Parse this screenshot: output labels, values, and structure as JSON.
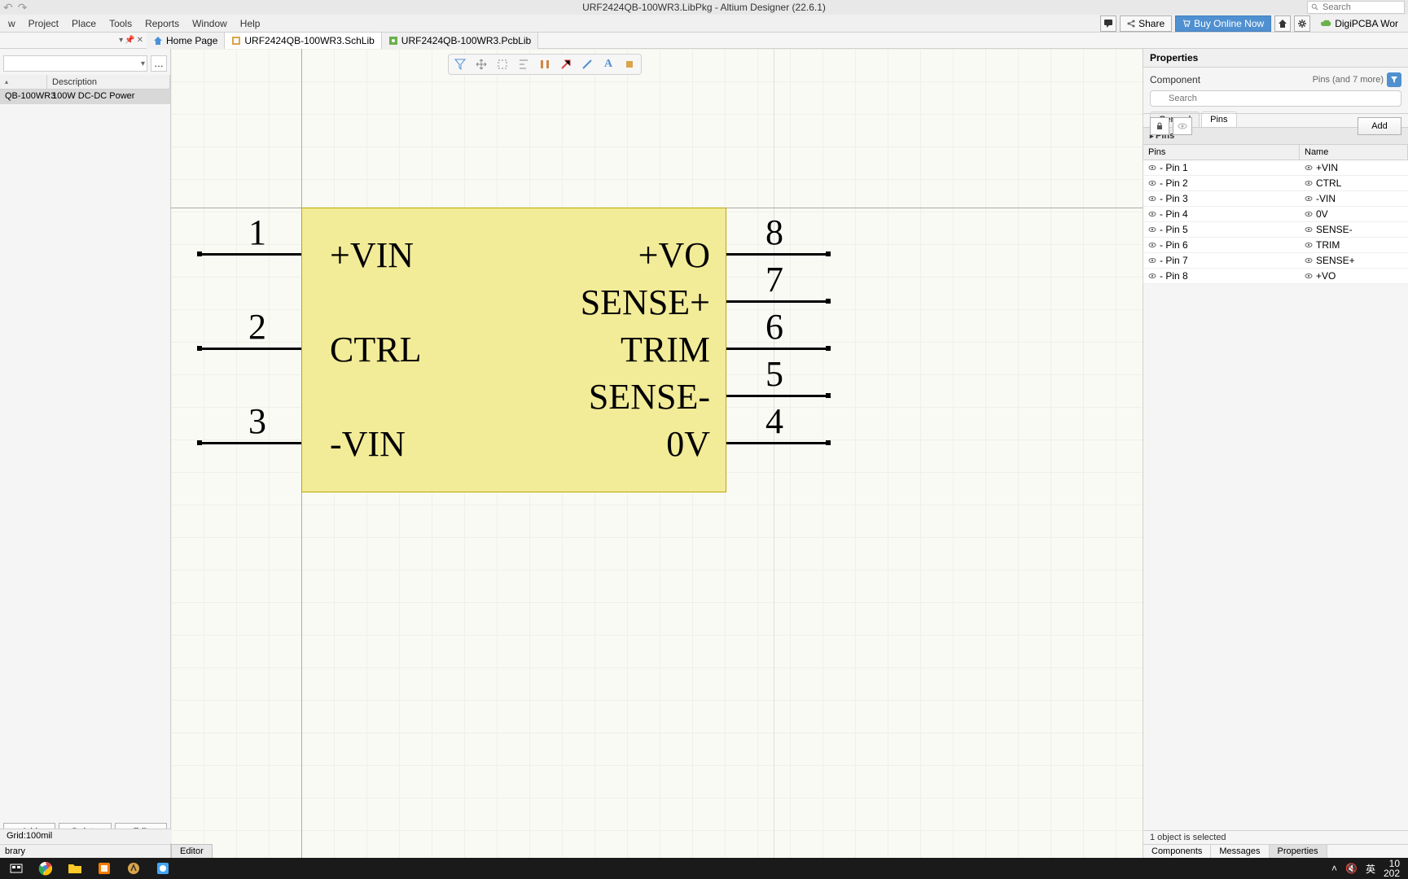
{
  "titlebar": {
    "title": "URF2424QB-100WR3.LibPkg - Altium Designer (22.6.1)"
  },
  "search": {
    "placeholder": "Search"
  },
  "menu": {
    "items": [
      "w",
      "Project",
      "Place",
      "Tools",
      "Reports",
      "Window",
      "Help"
    ]
  },
  "topright": {
    "share": "Share",
    "buy": "Buy Online Now",
    "digipcba": "DigiPCBA Wor"
  },
  "doctabs": {
    "home": "Home Page",
    "schlib": "URF2424QB-100WR3.SchLib",
    "pcblib": "URF2424QB-100WR3.PcbLib"
  },
  "leftgrid": {
    "header_desc": "Description",
    "row_name": "QB-100WR3",
    "row_desc": "100W DC-DC Power"
  },
  "leftbuttons": {
    "add": "Add",
    "delete": "Delete",
    "edit": "Edit"
  },
  "lefttab": "brary",
  "gridstatus": "Grid:100mil",
  "component": {
    "pins_left": [
      {
        "num": "1",
        "name": "+VIN"
      },
      {
        "num": "2",
        "name": "CTRL"
      },
      {
        "num": "3",
        "name": "-VIN"
      }
    ],
    "pins_right": [
      {
        "num": "8",
        "name": "+VO"
      },
      {
        "num": "7",
        "name": "SENSE+"
      },
      {
        "num": "6",
        "name": "TRIM"
      },
      {
        "num": "5",
        "name": "SENSE-"
      },
      {
        "num": "4",
        "name": "0V"
      }
    ]
  },
  "editor_tab": "Editor",
  "properties": {
    "title": "Properties",
    "component": "Component",
    "pins_more": "Pins (and 7 more)",
    "search_placeholder": "Search",
    "tab_general": "General",
    "tab_pins": "Pins",
    "section": "Pins",
    "col_pins": "Pins",
    "col_name": "Name",
    "rows": [
      {
        "pin": "- Pin 1",
        "name": "+VIN"
      },
      {
        "pin": "- Pin 2",
        "name": "CTRL"
      },
      {
        "pin": "- Pin 3",
        "name": "-VIN"
      },
      {
        "pin": "- Pin 4",
        "name": "0V"
      },
      {
        "pin": "- Pin 5",
        "name": "SENSE-"
      },
      {
        "pin": "- Pin 6",
        "name": "TRIM"
      },
      {
        "pin": "- Pin 7",
        "name": "SENSE+"
      },
      {
        "pin": "- Pin 8",
        "name": "+VO"
      }
    ],
    "add": "Add",
    "status": "1 object is selected",
    "bottom_tabs": [
      "Components",
      "Messages",
      "Properties"
    ]
  },
  "taskbar": {
    "ime": "英",
    "time": "10",
    "date": "202"
  }
}
